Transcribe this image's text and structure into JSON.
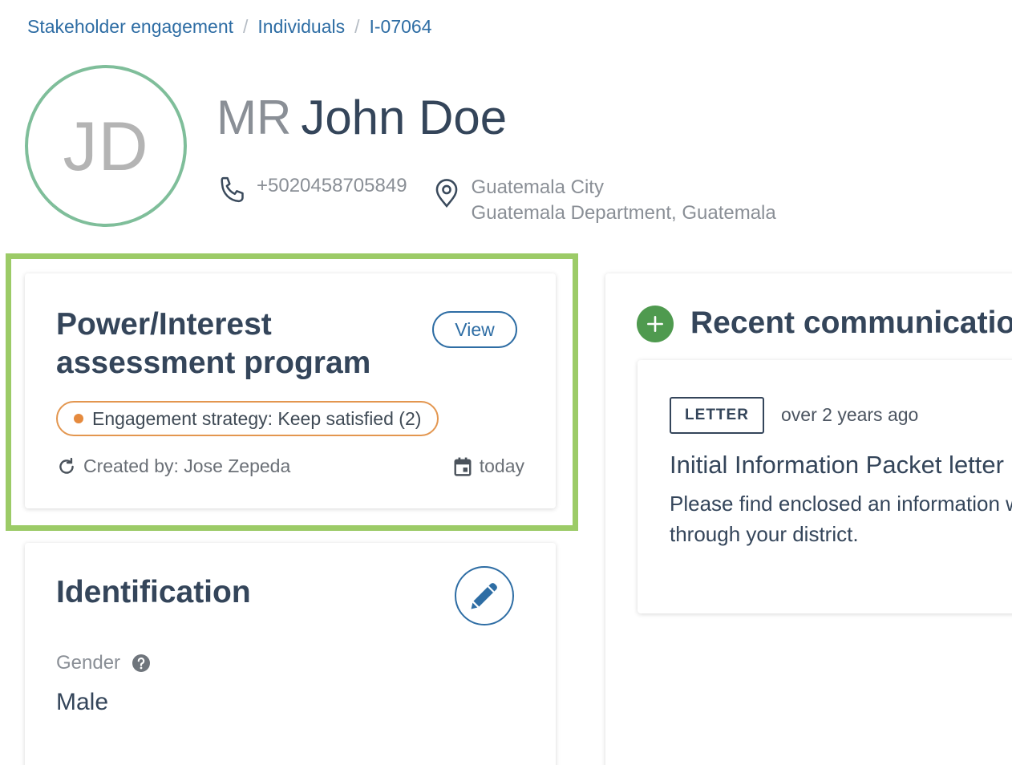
{
  "breadcrumb": {
    "items": [
      "Stakeholder engagement",
      "Individuals",
      "I-07064"
    ],
    "separator": "/"
  },
  "profile": {
    "initials": "JD",
    "title_prefix": "MR",
    "name": "John Doe",
    "phone": "+5020458705849",
    "city": "Guatemala City",
    "region": "Guatemala Department, Guatemala"
  },
  "assessment": {
    "title": "Power/Interest assessment program",
    "view_label": "View",
    "strategy": "Engagement strategy: Keep satisfied (2)",
    "created_by": "Created by: Jose Zepeda",
    "date": "today"
  },
  "identification": {
    "title": "Identification",
    "gender_label": "Gender",
    "gender_value": "Male"
  },
  "communications": {
    "title": "Recent communications",
    "item": {
      "type": "LETTER",
      "time": "over 2 years ago",
      "subject": "Initial Information Packet letter",
      "body": "Please find enclosed an information will pass through your district."
    }
  },
  "colors": {
    "link": "#2e6da4",
    "avatar_ring": "#7fbe9a",
    "highlight": "#9ccb67",
    "strategy_accent": "#e3964f",
    "add_button": "#4f9a4f"
  },
  "icons": {
    "phone": "phone-icon",
    "location": "map-pin-icon",
    "refresh": "refresh-icon",
    "calendar": "calendar-icon",
    "edit": "pencil-icon",
    "help": "help-circle-icon",
    "add": "plus-icon"
  }
}
